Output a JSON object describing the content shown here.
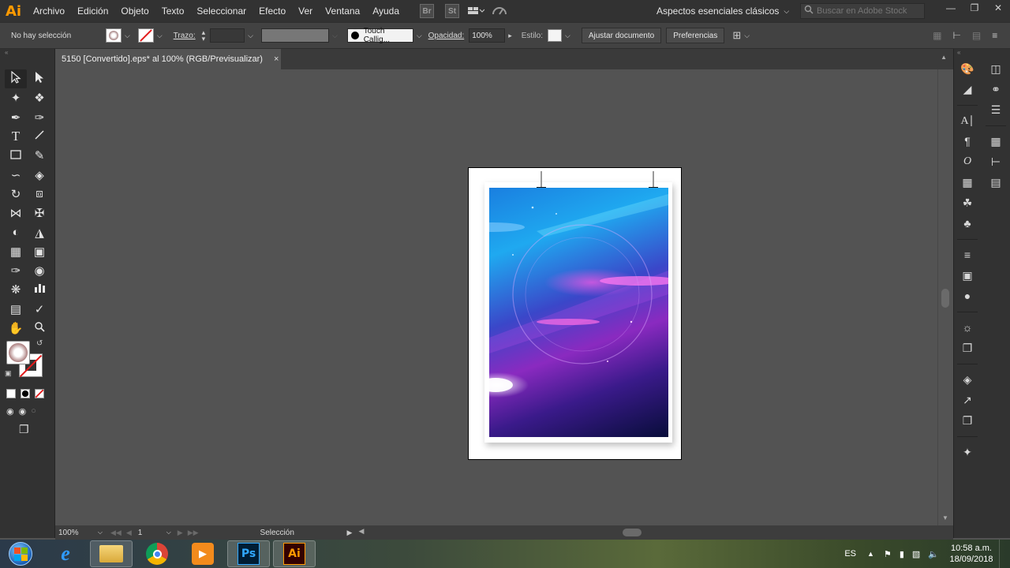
{
  "app": {
    "logo": "Ai"
  },
  "menu": {
    "items": [
      "Archivo",
      "Edición",
      "Objeto",
      "Texto",
      "Seleccionar",
      "Efecto",
      "Ver",
      "Ventana",
      "Ayuda"
    ],
    "bridge_icon": "Br",
    "stock_icon": "St",
    "workspace": "Aspectos esenciales clásicos",
    "search_placeholder": "Buscar en Adobe Stock"
  },
  "control_bar": {
    "selection_status": "No hay selección",
    "stroke_label": "Trazo:",
    "brush_name": "Touch Callig...",
    "opacity_label": "Opacidad:",
    "opacity_value": "100%",
    "style_label": "Estilo:",
    "adjust_button": "Ajustar documento",
    "preferences_button": "Preferencias"
  },
  "document": {
    "tab_title": "5150 [Convertido].eps* al 100% (RGB/Previsualizar)",
    "close_glyph": "×"
  },
  "status_bar": {
    "zoom": "100%",
    "artboard_number": "1",
    "tool_name": "Selección"
  },
  "taskbar": {
    "language": "ES",
    "time": "10:58 a.m.",
    "date": "18/09/2018",
    "apps": [
      "internet-explorer",
      "file-explorer",
      "chrome",
      "media-player",
      "photoshop",
      "illustrator"
    ],
    "ps_label": "Ps",
    "ai_label": "Ai"
  },
  "colors": {
    "ai_orange": "#ff9a00",
    "ps_blue": "#31a8ff",
    "ui_dark": "#323232",
    "canvas": "#535353"
  }
}
